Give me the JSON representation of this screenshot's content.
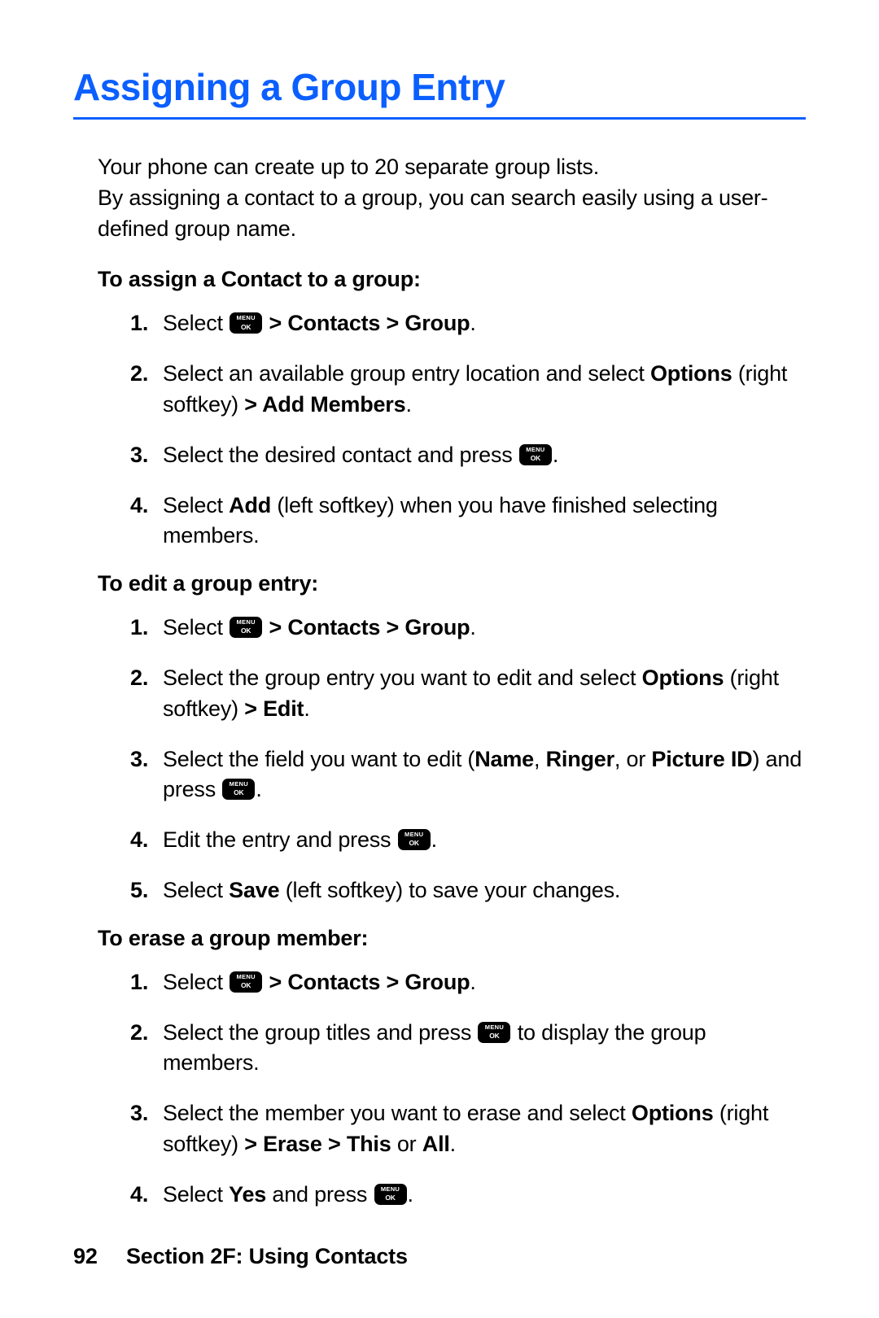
{
  "title": "Assigning a Group Entry",
  "intro": "Your phone can create up to 20 separate group lists.\nBy assigning a contact to a group, you can search easily using a user-defined group name.",
  "sections": [
    {
      "heading": "To assign a Contact to a group:",
      "steps": [
        [
          {
            "t": "Select "
          },
          {
            "icon": "menu-ok"
          },
          {
            "t": " "
          },
          {
            "b": "> Contacts > Group"
          },
          {
            "t": "."
          }
        ],
        [
          {
            "t": "Select an available group entry location and select "
          },
          {
            "b": "Options"
          },
          {
            "t": " (right softkey) "
          },
          {
            "b": "> Add Members"
          },
          {
            "t": "."
          }
        ],
        [
          {
            "t": "Select the desired contact and press "
          },
          {
            "icon": "menu-ok"
          },
          {
            "t": "."
          }
        ],
        [
          {
            "t": "Select "
          },
          {
            "b": "Add"
          },
          {
            "t": " (left softkey) when you have finished selecting members."
          }
        ]
      ]
    },
    {
      "heading": "To edit a group entry:",
      "steps": [
        [
          {
            "t": "Select "
          },
          {
            "icon": "menu-ok"
          },
          {
            "t": " "
          },
          {
            "b": "> Contacts > Group"
          },
          {
            "t": "."
          }
        ],
        [
          {
            "t": "Select the group entry you want to edit and select "
          },
          {
            "b": "Options"
          },
          {
            "t": " (right softkey) "
          },
          {
            "b": "> Edit"
          },
          {
            "t": "."
          }
        ],
        [
          {
            "t": "Select the field you want to edit ("
          },
          {
            "b": "Name"
          },
          {
            "t": ", "
          },
          {
            "b": "Ringer"
          },
          {
            "t": ", or "
          },
          {
            "b": "Picture ID"
          },
          {
            "t": ") and press "
          },
          {
            "icon": "menu-ok"
          },
          {
            "t": "."
          }
        ],
        [
          {
            "t": "Edit the entry and press "
          },
          {
            "icon": "menu-ok"
          },
          {
            "t": "."
          }
        ],
        [
          {
            "t": "Select "
          },
          {
            "b": "Save"
          },
          {
            "t": " (left softkey) to save your changes."
          }
        ]
      ]
    },
    {
      "heading": "To erase a group member:",
      "steps": [
        [
          {
            "t": "Select "
          },
          {
            "icon": "menu-ok"
          },
          {
            "t": " "
          },
          {
            "b": "> Contacts > Group"
          },
          {
            "t": "."
          }
        ],
        [
          {
            "t": "Select the group titles and press "
          },
          {
            "icon": "menu-ok"
          },
          {
            "t": " to display the group members."
          }
        ],
        [
          {
            "t": "Select the member you want to erase and select "
          },
          {
            "b": "Options"
          },
          {
            "t": " (right softkey) "
          },
          {
            "b": "> Erase > This"
          },
          {
            "t": " or "
          },
          {
            "b": "All"
          },
          {
            "t": "."
          }
        ],
        [
          {
            "t": "Select "
          },
          {
            "b": "Yes"
          },
          {
            "t": " and press "
          },
          {
            "icon": "menu-ok"
          },
          {
            "t": "."
          }
        ]
      ]
    }
  ],
  "footer": {
    "page": "92",
    "section": "Section 2F: Using Contacts"
  }
}
